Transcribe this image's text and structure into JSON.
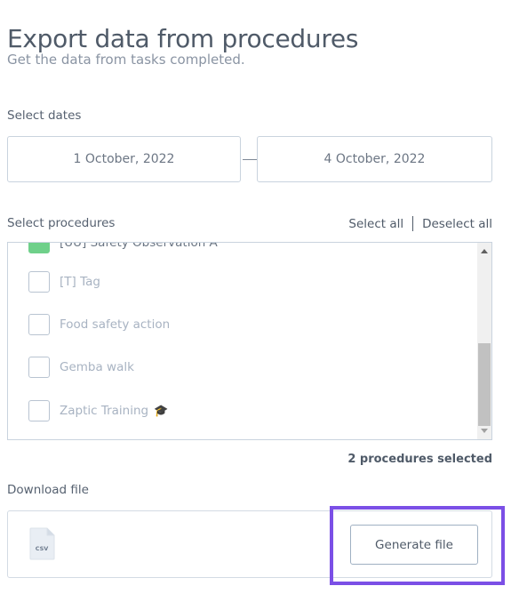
{
  "page": {
    "title": "Export data from procedures",
    "subtitle": "Get the data from tasks completed."
  },
  "dates": {
    "label": "Select dates",
    "start": "1 October, 2022",
    "end": "4 October, 2022"
  },
  "procedures": {
    "label": "Select procedures",
    "select_all": "Select all",
    "deselect_all": "Deselect all",
    "items": [
      {
        "label": "[UU] Safety Observation A",
        "checked": true
      },
      {
        "label": "[T] Tag",
        "checked": false
      },
      {
        "label": "Food safety action",
        "checked": false
      },
      {
        "label": "Gemba walk",
        "checked": false
      },
      {
        "label": "Zaptic Training",
        "checked": false,
        "emoji": "🎓"
      }
    ],
    "selected_count": "2 procedures selected"
  },
  "download": {
    "label": "Download file",
    "file_type": "CSV",
    "generate_label": "Generate file"
  },
  "colors": {
    "highlight": "#7b4fe6",
    "checked": "#6fd08a"
  }
}
